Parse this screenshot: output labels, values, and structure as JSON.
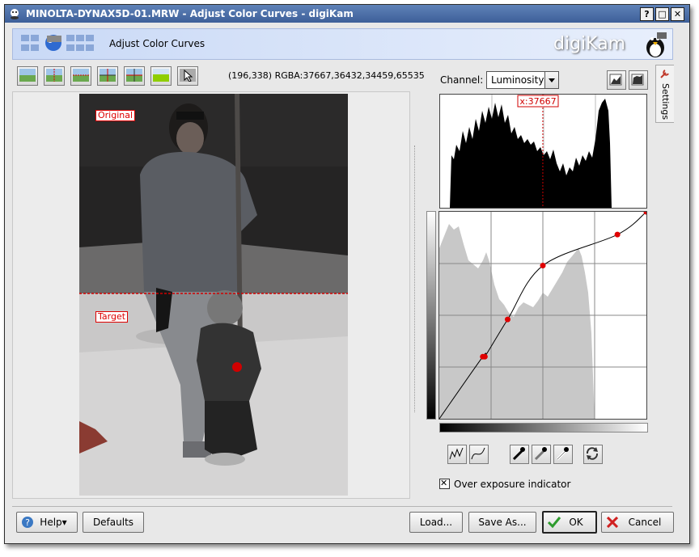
{
  "window": {
    "title": "MINOLTA-DYNAX5D-01.MRW - Adjust Color Curves - digiKam",
    "controls": {
      "help": "?",
      "maximize": "□",
      "close": "✕"
    }
  },
  "header": {
    "plugin_title": "Adjust Color Curves",
    "brand": "digiKam"
  },
  "preview": {
    "pixel_info": "(196,338) RGBA:37667,36432,34459,65535",
    "original_label": "Original",
    "target_label": "Target",
    "toolbar_icons": [
      "original-image-icon",
      "split-vertical-icon",
      "split-horizontal-icon",
      "split-vertical-dup-icon",
      "split-horizontal-dup-icon",
      "target-image-icon",
      "under-over-exposure-icon"
    ]
  },
  "controls": {
    "channel_label": "Channel:",
    "channel_value": "Luminosity",
    "histogram_marker": "x:37667",
    "histogram_marker_value": 37667,
    "histogram_max": 65535,
    "settings_tab": "Settings",
    "overexposure_label": "Over exposure indicator",
    "overexposure_checked": true
  },
  "curve": {
    "points": [
      [
        0,
        0
      ],
      [
        0.21,
        0.3
      ],
      [
        0.22,
        0.3
      ],
      [
        0.33,
        0.48
      ],
      [
        0.5,
        0.74
      ],
      [
        0.86,
        0.89
      ],
      [
        1,
        1
      ]
    ]
  },
  "buttons": {
    "help": "Help",
    "defaults": "Defaults",
    "load": "Load...",
    "save_as": "Save As...",
    "ok": "OK",
    "cancel": "Cancel"
  },
  "colors": {
    "title_bar": "#3d5f99",
    "accent_red": "#d00000",
    "header_bg": "#c9d9f6"
  }
}
